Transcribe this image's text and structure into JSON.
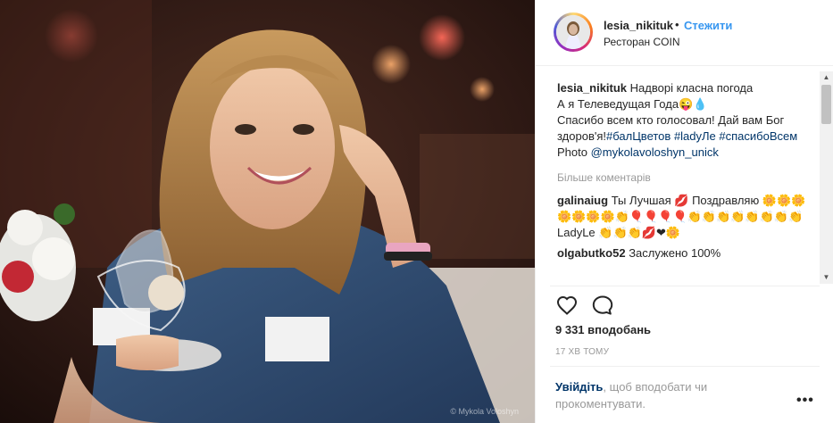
{
  "post": {
    "photo_credit": "© Mykola Voloshyn",
    "image_name": "photo"
  },
  "header": {
    "username": "lesia_nikituk",
    "separator": "•",
    "follow_label": "Стежити",
    "location": "Ресторан COIN"
  },
  "caption": {
    "username": "lesia_nikituk",
    "line1": "Надворі класна погода",
    "line2": "А я Телеведущая Года😜💧",
    "line3": "  Спасибо всем кто голосовал! Дай вам Бог здоров'я!",
    "tag1": "#балЦветов",
    "tag2": "#ladyЛе",
    "tag3": "#спасибоВсем",
    "after_tag3": " Photo",
    "mention": "@mykolavoloshyn_unick"
  },
  "more_comments_label": "Більше коментарів",
  "comments": [
    {
      "user": "galinaiug",
      "text": "Ты Лучшая 💋 Поздравляю 🌼🌼🌼🌼🌼🌼🌼👏🎈🎈🎈🎈👏👏👏👏👏👏👏👏 LadyLe 👏👏👏💋❤🌼"
    },
    {
      "user": "olgabutko52",
      "text": "Заслужено 100%"
    }
  ],
  "actions": {
    "like_icon": "heart-icon",
    "comment_icon": "speech-bubble-icon"
  },
  "likes_text": "9 331 вподобань",
  "timestamp": "17 ХВ ТОМУ",
  "login_prompt": {
    "link": "Увійдіть",
    "rest": ", щоб вподобати чи прокоментувати."
  },
  "options_label": "•••",
  "colors": {
    "link_blue": "#3897f0",
    "hashtag": "#003569",
    "muted": "#999999"
  }
}
